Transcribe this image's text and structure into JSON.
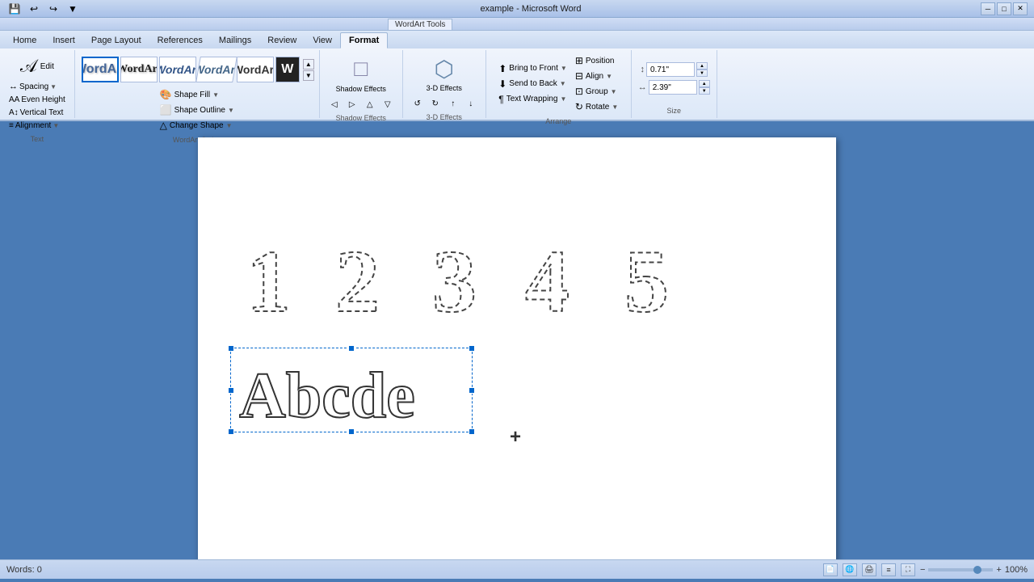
{
  "titlebar": {
    "title": "example - Microsoft Word",
    "wordart_tools": "WordArt Tools"
  },
  "tabs": {
    "items": [
      "Home",
      "Insert",
      "Page Layout",
      "References",
      "Mailings",
      "Review",
      "View",
      "Format"
    ],
    "active": "Format"
  },
  "ribbon": {
    "text_group": {
      "label": "Text",
      "edit_label": "Edit",
      "spacing_label": "Spacing",
      "even_height_label": "Even Height",
      "vertical_text_label": "Vertical Text",
      "alignment_label": "Alignment"
    },
    "wordart_styles_group": {
      "label": "WordArt Styles",
      "shape_fill_label": "Shape Fill",
      "shape_outline_label": "Shape Outline",
      "change_shape_label": "Change Shape",
      "styles": [
        "WordArt",
        "WordArt",
        "WordArt",
        "WordArt",
        "WordArt",
        "W"
      ]
    },
    "shadow_effects_group": {
      "label": "Shadow Effects",
      "shadow_effects_label": "Shadow Effects"
    },
    "threed_effects_group": {
      "label": "3-D Effects",
      "threed_effects_label": "3-D Effects"
    },
    "arrange_group": {
      "label": "Arrange",
      "bring_to_front_label": "Bring to Front",
      "send_to_back_label": "Send to Back",
      "text_wrapping_label": "Text Wrapping",
      "align_label": "Align",
      "group_label": "Group",
      "rotate_label": "Rotate",
      "position_label": "Position"
    },
    "size_group": {
      "label": "Size",
      "height_value": "0.71\"",
      "width_value": "2.39\""
    }
  },
  "document": {
    "numbers": [
      "1",
      "2",
      "3",
      "4",
      "5"
    ],
    "text": "A b c d e"
  },
  "statusbar": {
    "words_label": "Words: 0",
    "zoom_label": "100%",
    "view_buttons": [
      "Normal",
      "Web Layout",
      "Print Layout",
      "Outline",
      "Full Screen"
    ]
  }
}
